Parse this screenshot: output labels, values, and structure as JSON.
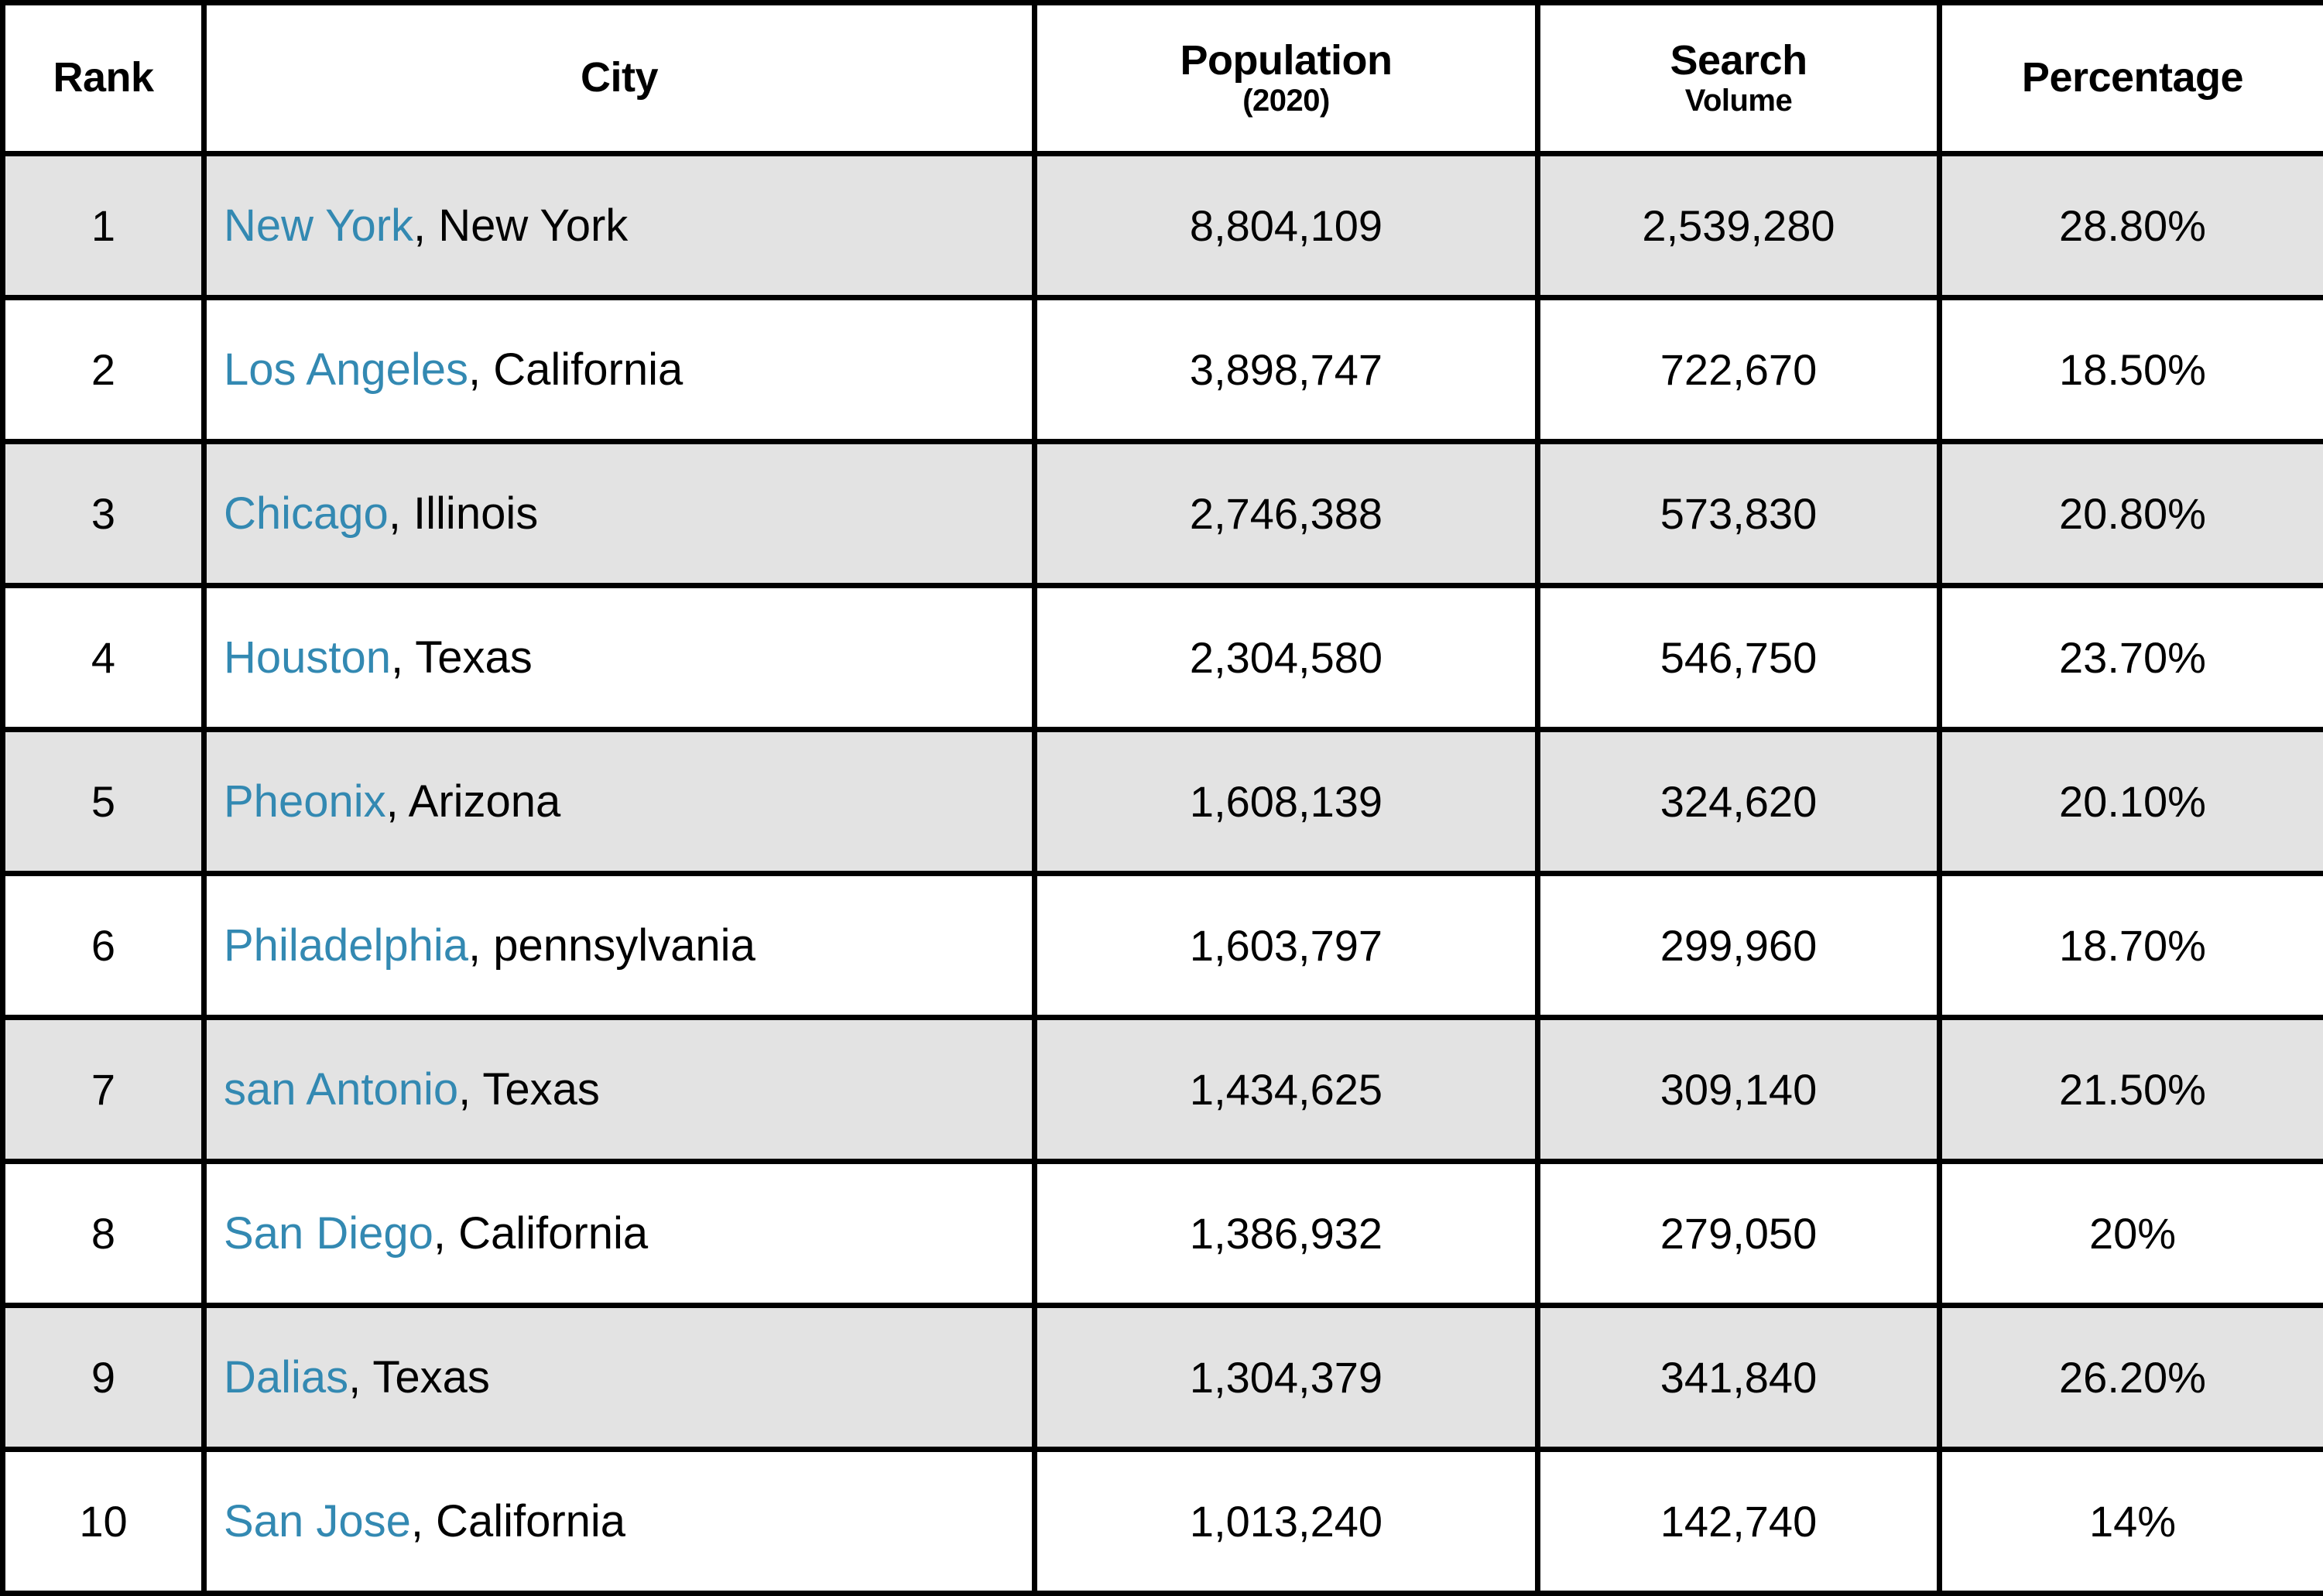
{
  "table": {
    "columns": [
      {
        "key": "rank",
        "label": "Rank",
        "sub": ""
      },
      {
        "key": "city",
        "label": "City",
        "sub": ""
      },
      {
        "key": "population",
        "label": "Population",
        "sub": "(2020)"
      },
      {
        "key": "volume",
        "label": "Search",
        "sub": "Volume"
      },
      {
        "key": "percentage",
        "label": "Percentage",
        "sub": ""
      }
    ],
    "colors": {
      "city_link": "#3389b2",
      "text": "#000000",
      "row_shaded": "#e3e3e3",
      "row_plain": "#ffffff",
      "border": "#000000"
    },
    "rows": [
      {
        "rank": "1",
        "city": "New York",
        "state": ", New York",
        "population": "8,804,109",
        "volume": "2,539,280",
        "percentage": "28.80%"
      },
      {
        "rank": "2",
        "city": "Los Angeles",
        "state": ", California",
        "population": "3,898,747",
        "volume": "722,670",
        "percentage": "18.50%"
      },
      {
        "rank": "3",
        "city": "Chicago",
        "state": ", Illinois",
        "population": "2,746,388",
        "volume": "573,830",
        "percentage": "20.80%"
      },
      {
        "rank": "4",
        "city": "Houston",
        "state": ", Texas",
        "population": "2,304,580",
        "volume": "546,750",
        "percentage": "23.70%"
      },
      {
        "rank": "5",
        "city": "Pheonix",
        "state": ", Arizona",
        "population": "1,608,139",
        "volume": "324,620",
        "percentage": "20.10%"
      },
      {
        "rank": "6",
        "city": "Philadelphia",
        "state": ", pennsylvania",
        "population": "1,603,797",
        "volume": "299,960",
        "percentage": "18.70%"
      },
      {
        "rank": "7",
        "city": "san Antonio",
        "state": ", Texas",
        "population": "1,434,625",
        "volume": "309,140",
        "percentage": "21.50%"
      },
      {
        "rank": "8",
        "city": "San Diego",
        "state": ", California",
        "population": "1,386,932",
        "volume": "279,050",
        "percentage": "20%"
      },
      {
        "rank": "9",
        "city": "Dalias",
        "state": ", Texas",
        "population": "1,304,379",
        "volume": "341,840",
        "percentage": "26.20%"
      },
      {
        "rank": "10",
        "city": "San Jose",
        "state": ", California",
        "population": "1,013,240",
        "volume": "142,740",
        "percentage": "14%"
      }
    ]
  }
}
